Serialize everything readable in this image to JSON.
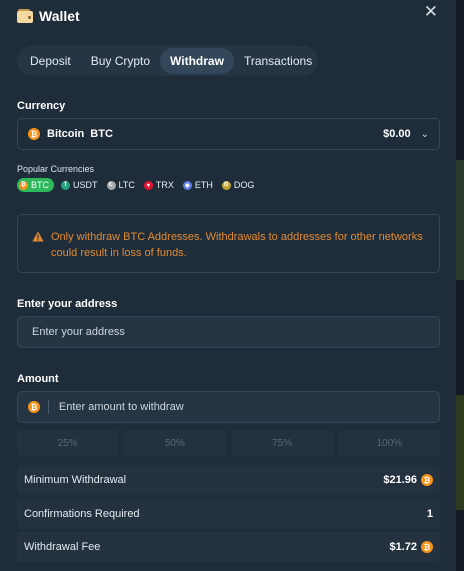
{
  "colors": {
    "accent": "#2db85c",
    "warning": "#e28a30",
    "btc": "#f7931a",
    "panel_bg": "#1f2d3a"
  },
  "header": {
    "title": "Wallet",
    "wallet_icon": "wallet-icon",
    "close_glyph": "✕"
  },
  "tabs": [
    {
      "label": "Deposit",
      "active": false
    },
    {
      "label": "Buy Crypto",
      "active": false
    },
    {
      "label": "Withdraw",
      "active": true
    },
    {
      "label": "Transactions",
      "active": false
    }
  ],
  "currency": {
    "label": "Currency",
    "selected": {
      "name": "Bitcoin",
      "symbol": "BTC",
      "balance": "$0.00",
      "icon": "bitcoin-icon"
    },
    "popular_label": "Popular Currencies",
    "popular": [
      {
        "symbol": "BTC",
        "icon": "bitcoin-icon",
        "color": "#f7931a",
        "active": true
      },
      {
        "symbol": "USDT",
        "icon": "tether-icon",
        "color": "#26a17b",
        "active": false
      },
      {
        "symbol": "LTC",
        "icon": "litecoin-icon",
        "color": "#a6a9aa",
        "active": false
      },
      {
        "symbol": "TRX",
        "icon": "tron-icon",
        "color": "#e8112d",
        "active": false
      },
      {
        "symbol": "ETH",
        "icon": "ethereum-icon",
        "color": "#627eea",
        "active": false
      },
      {
        "symbol": "DOG",
        "icon": "dogecoin-icon",
        "color": "#c2a633",
        "active": false
      }
    ]
  },
  "warning": {
    "text": "Only withdraw BTC Addresses. Withdrawals to addresses for other networks could result in loss of funds."
  },
  "address": {
    "label": "Enter your address",
    "placeholder": "Enter your address",
    "value": ""
  },
  "amount": {
    "label": "Amount",
    "placeholder": "Enter amount to withdraw",
    "value": "",
    "percent_buttons": [
      "25%",
      "50%",
      "75%",
      "100%"
    ]
  },
  "info": [
    {
      "label": "Minimum Withdrawal",
      "value": "$21.96",
      "coin_icon": true
    },
    {
      "label": "Confirmations Required",
      "value": "1",
      "coin_icon": false
    },
    {
      "label": "Withdrawal Fee",
      "value": "$1.72",
      "coin_icon": true
    }
  ]
}
